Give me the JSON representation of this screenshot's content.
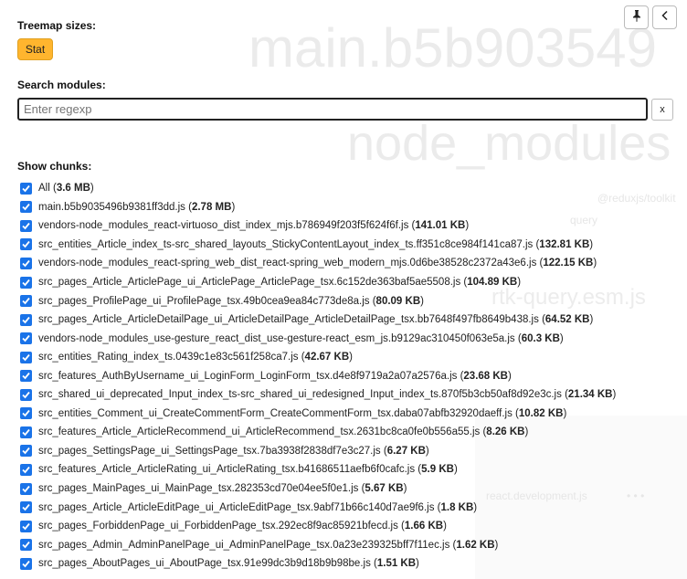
{
  "background": {
    "large_text_1": "main.b5b903549",
    "large_text_2": "node_modules",
    "large_text_3": "rtk-query.esm.js",
    "small_text_1": "@reduxjs/toolkit",
    "small_text_2": "query",
    "small_text_3": "react.development.js",
    "dots": "• • •"
  },
  "controls": {
    "pin_icon": "pin-icon",
    "collapse_icon": "chevron-left-icon"
  },
  "treemap": {
    "label": "Treemap sizes:",
    "stat_button": "Stat"
  },
  "search": {
    "label": "Search modules:",
    "placeholder": "Enter regexp",
    "value": "",
    "clear_label": "x"
  },
  "chunks": {
    "label": "Show chunks:",
    "items": [
      {
        "name": "All",
        "size": "3.6 MB",
        "checked": true
      },
      {
        "name": "main.b5b9035496b9381ff3dd.js",
        "size": "2.78 MB",
        "checked": true
      },
      {
        "name": "vendors-node_modules_react-virtuoso_dist_index_mjs.b786949f203f5f624f6f.js",
        "size": "141.01 KB",
        "checked": true
      },
      {
        "name": "src_entities_Article_index_ts-src_shared_layouts_StickyContentLayout_index_ts.ff351c8ce984f141ca87.js",
        "size": "132.81 KB",
        "checked": true
      },
      {
        "name": "vendors-node_modules_react-spring_web_dist_react-spring_web_modern_mjs.0d6be38528c2372a43e6.js",
        "size": "122.15 KB",
        "checked": true
      },
      {
        "name": "src_pages_Article_ArticlePage_ui_ArticlePage_ArticlePage_tsx.6c152de363baf5ae5508.js",
        "size": "104.89 KB",
        "checked": true
      },
      {
        "name": "src_pages_ProfilePage_ui_ProfilePage_tsx.49b0cea9ea84c773de8a.js",
        "size": "80.09 KB",
        "checked": true
      },
      {
        "name": "src_pages_Article_ArticleDetailPage_ui_ArticleDetailPage_ArticleDetailPage_tsx.bb7648f497fb8649b438.js",
        "size": "64.52 KB",
        "checked": true
      },
      {
        "name": "vendors-node_modules_use-gesture_react_dist_use-gesture-react_esm_js.b9129ac310450f063e5a.js",
        "size": "60.3 KB",
        "checked": true
      },
      {
        "name": "src_entities_Rating_index_ts.0439c1e83c561f258ca7.js",
        "size": "42.67 KB",
        "checked": true
      },
      {
        "name": "src_features_AuthByUsername_ui_LoginForm_LoginForm_tsx.d4e8f9719a2a07a2576a.js",
        "size": "23.68 KB",
        "checked": true
      },
      {
        "name": "src_shared_ui_deprecated_Input_index_ts-src_shared_ui_redesigned_Input_index_ts.870f5b3cb50af8d92e3c.js",
        "size": "21.34 KB",
        "checked": true
      },
      {
        "name": "src_entities_Comment_ui_CreateCommentForm_CreateCommentForm_tsx.daba07abfb32920daeff.js",
        "size": "10.82 KB",
        "checked": true
      },
      {
        "name": "src_features_Article_ArticleRecommend_ui_ArticleRecommend_tsx.2631bc8ca0fe0b556a55.js",
        "size": "8.26 KB",
        "checked": true
      },
      {
        "name": "src_pages_SettingsPage_ui_SettingsPage_tsx.7ba3938f2838df7e3c27.js",
        "size": "6.27 KB",
        "checked": true
      },
      {
        "name": "src_features_Article_ArticleRating_ui_ArticleRating_tsx.b41686511aefb6f0cafc.js",
        "size": "5.9 KB",
        "checked": true
      },
      {
        "name": "src_pages_MainPages_ui_MainPage_tsx.282353cd70e04ee5f0e1.js",
        "size": "5.67 KB",
        "checked": true
      },
      {
        "name": "src_pages_Article_ArticleEditPage_ui_ArticleEditPage_tsx.9abf71b66c140d7ae9f6.js",
        "size": "1.8 KB",
        "checked": true
      },
      {
        "name": "src_pages_ForbiddenPage_ui_ForbiddenPage_tsx.292ec8f9ac85921bfecd.js",
        "size": "1.66 KB",
        "checked": true
      },
      {
        "name": "src_pages_Admin_AdminPanelPage_ui_AdminPanelPage_tsx.0a23e239325bff7f11ec.js",
        "size": "1.62 KB",
        "checked": true
      },
      {
        "name": "src_pages_AboutPages_ui_AboutPage_tsx.91e99dc3b9d18b9b98be.js",
        "size": "1.51 KB",
        "checked": true
      }
    ]
  },
  "colors": {
    "accent": "#ffb52e",
    "checkbox": "#1a73e8"
  }
}
